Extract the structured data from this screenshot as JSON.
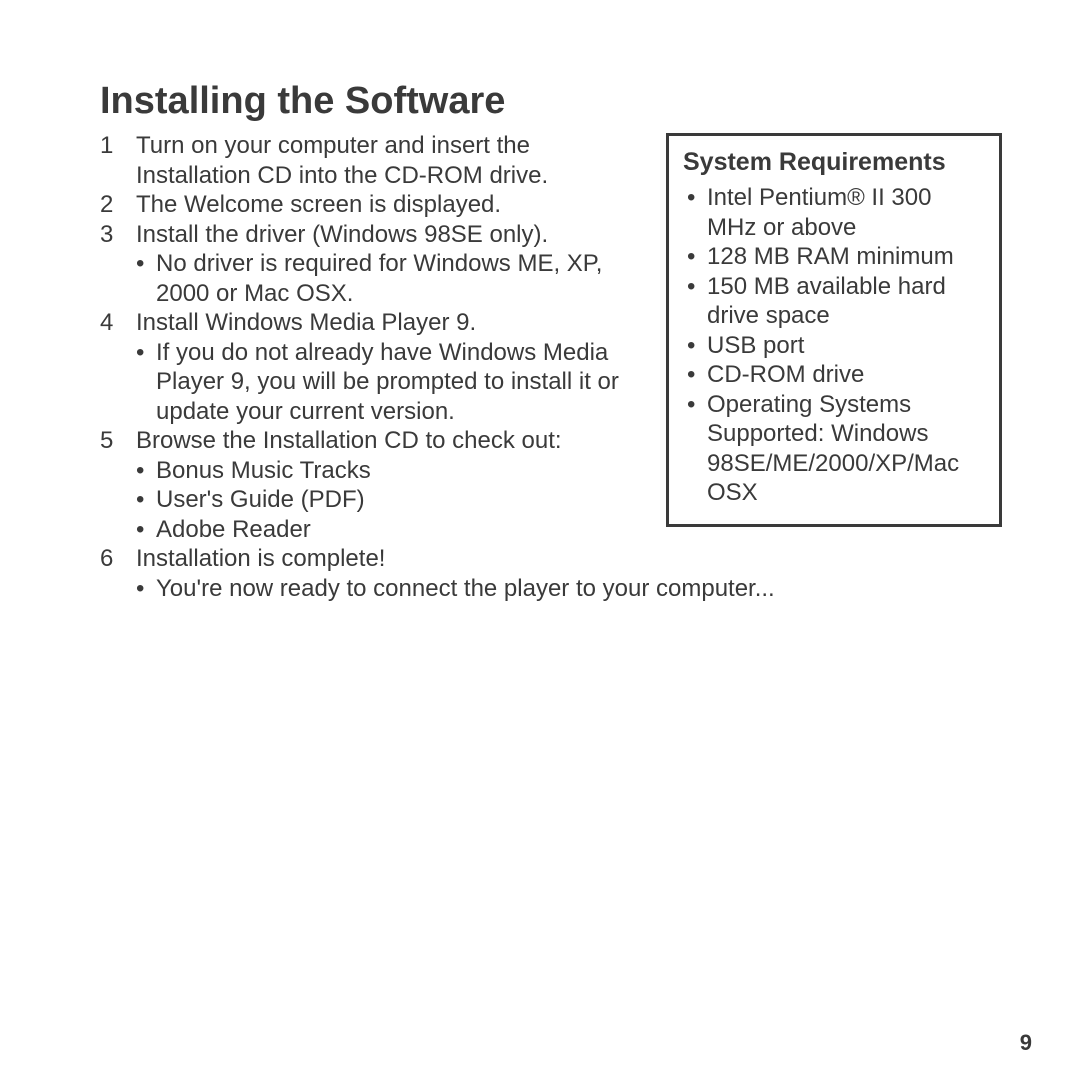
{
  "title": "Installing the Software",
  "steps": [
    {
      "text": "Turn on your computer and insert the Installation CD into the CD-ROM drive.",
      "sub": []
    },
    {
      "text": "The Welcome screen is displayed.",
      "sub": []
    },
    {
      "text": "Install the driver (Windows 98SE only).",
      "sub": [
        "No driver is required for Windows ME, XP, 2000 or Mac OSX."
      ]
    },
    {
      "text": "Install Windows Media Player 9.",
      "sub": [
        "If you do not already have Windows Media Player 9, you will be prompted to install it or update your current version."
      ]
    },
    {
      "text": "Browse the Installation CD to check out:",
      "sub": [
        "Bonus Music Tracks",
        "User's Guide (PDF)",
        "Adobe Reader"
      ]
    },
    {
      "text": "Installation is complete!",
      "sub": [
        "You're now ready to connect the player to your computer..."
      ]
    }
  ],
  "sidebar": {
    "title": "System Requirements",
    "items": [
      "Intel Pentium® II 300 MHz or above",
      "128 MB RAM minimum",
      "150 MB available hard drive space",
      "USB port",
      "CD-ROM drive",
      "Operating Systems Supported: Windows 98SE/ME/2000/XP/Mac OSX"
    ]
  },
  "page_number": "9"
}
